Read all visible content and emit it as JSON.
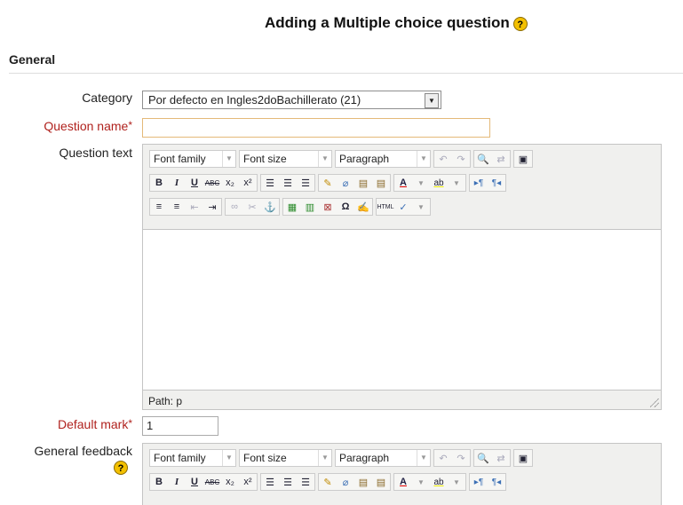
{
  "page_title": "Adding a Multiple choice question",
  "help_glyph": "?",
  "section": "General",
  "fields": {
    "category_label": "Category",
    "category_value": "Por defecto en Ingles2doBachillerato (21)",
    "question_name_label": "Question name",
    "required_star": "*",
    "question_name_value": "",
    "question_text_label": "Question text",
    "default_mark_label": "Default mark",
    "default_mark_value": "1",
    "general_feedback_label": "General feedback"
  },
  "editor": {
    "font_family": "Font family",
    "font_size": "Font size",
    "paragraph": "Paragraph",
    "path": "Path: p"
  },
  "colors": {
    "required": "#b0221e",
    "help_icon": "#f3c000"
  }
}
